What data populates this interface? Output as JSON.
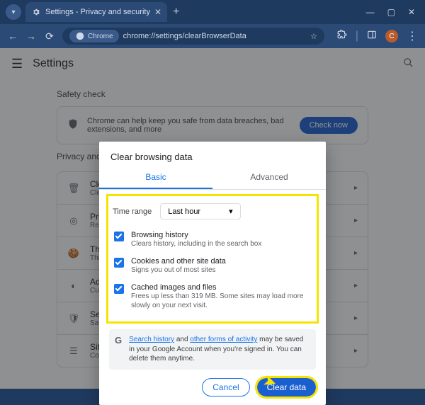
{
  "titlebar": {
    "tab_title": "Settings - Privacy and security"
  },
  "urlbar": {
    "chip_label": "Chrome",
    "url": "chrome://settings/clearBrowserData"
  },
  "appbar": {
    "title": "Settings"
  },
  "safety": {
    "section": "Safety check",
    "text": "Chrome can help keep you safe from data breaches, bad extensions, and more",
    "button": "Check now"
  },
  "privacy": {
    "section": "Privacy and security",
    "rows": [
      {
        "title": "Clear browsing data",
        "sub": "Clear history, cookies, cache, and more"
      },
      {
        "title": "Privacy Guide",
        "sub": "Review key privacy and security controls"
      },
      {
        "title": "Third-party cookies",
        "sub": "Third-party cookies are blocked in Incognito mode"
      },
      {
        "title": "Ad privacy",
        "sub": "Customize the info used by sites to show you ads"
      },
      {
        "title": "Security",
        "sub": "Safe Browsing (protection from dangerous sites) and other security settings"
      },
      {
        "title": "Site settings",
        "sub": "Controls what information sites can use and show"
      }
    ]
  },
  "dialog": {
    "title": "Clear browsing data",
    "tab_basic": "Basic",
    "tab_advanced": "Advanced",
    "time_label": "Time range",
    "time_value": "Last hour",
    "items": [
      {
        "title": "Browsing history",
        "sub": "Clears history, including in the search box"
      },
      {
        "title": "Cookies and other site data",
        "sub": "Signs you out of most sites"
      },
      {
        "title": "Cached images and files",
        "sub": "Frees up less than 319 MB. Some sites may load more slowly on your next visit."
      }
    ],
    "note_link1": "Search history",
    "note_mid": " and ",
    "note_link2": "other forms of activity",
    "note_rest": " may be saved in your Google Account when you're signed in. You can delete them anytime.",
    "cancel": "Cancel",
    "clear": "Clear data"
  }
}
